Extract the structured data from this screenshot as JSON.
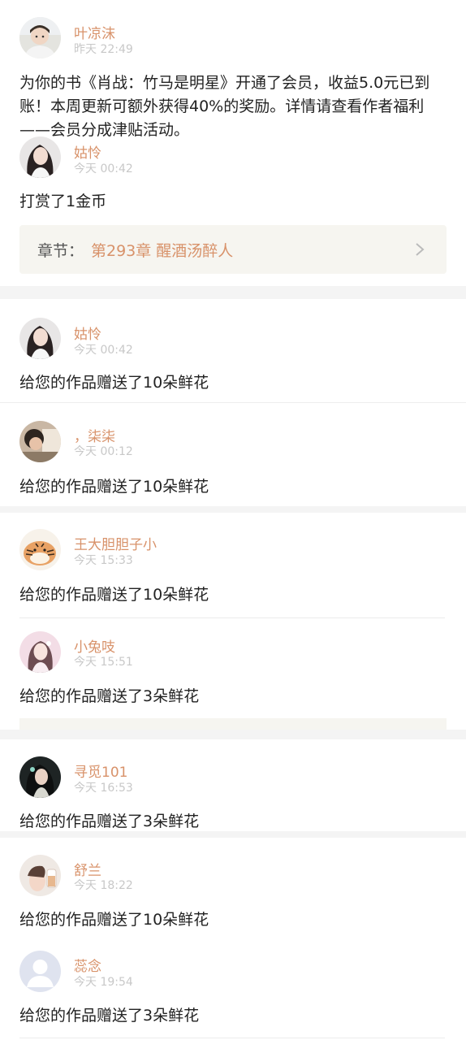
{
  "colors": {
    "accent": "#d8926a",
    "muted": "#c8c8c8",
    "text": "#222222",
    "separator": "#f4f4f4",
    "chapter_bg": "#f6f5f0"
  },
  "entries": [
    {
      "avatar": "avatar-boy-photo",
      "name": "叶凉沫",
      "time": "昨天 22:49",
      "message": "为你的书《肖战：竹马是明星》开通了会员，收益5.0元已到账！本周更新可额外获得40%的奖励。详情请查看作者福利——会员分成津贴活动。"
    },
    {
      "avatar": "avatar-girl-photo",
      "name": "姑怜",
      "time": "今天 00:42",
      "message": "打赏了1金币",
      "chapter": {
        "label": "章节：",
        "value": "第293章 醒酒汤醉人",
        "icon": "chevron-right-icon"
      }
    },
    {
      "avatar": "avatar-girl-photo",
      "name": "姑怜",
      "time": "今天 00:42",
      "message": "给您的作品赠送了10朵鲜花"
    },
    {
      "avatar": "avatar-child-photo",
      "name": "，柒柒",
      "time": "今天 00:12",
      "message": "给您的作品赠送了10朵鲜花"
    },
    {
      "avatar": "avatar-tiger-cartoon",
      "name": "王大胆胆子小",
      "time": "今天 15:33",
      "message": "给您的作品赠送了10朵鲜花"
    },
    {
      "avatar": "avatar-girl-pink-photo",
      "name": "小兔吱",
      "time": "今天 15:51",
      "message": "给您的作品赠送了3朵鲜花"
    },
    {
      "avatar": "avatar-girl-dark-photo",
      "name": "寻觅101",
      "time": "今天 16:53",
      "message": "给您的作品赠送了3朵鲜花"
    },
    {
      "avatar": "avatar-drink-photo",
      "name": "舒兰",
      "time": "今天 18:22",
      "message": "给您的作品赠送了10朵鲜花"
    },
    {
      "avatar": "avatar-default-user-icon",
      "name": "蕊念",
      "time": "今天 19:54",
      "message": "给您的作品赠送了3朵鲜花"
    }
  ]
}
